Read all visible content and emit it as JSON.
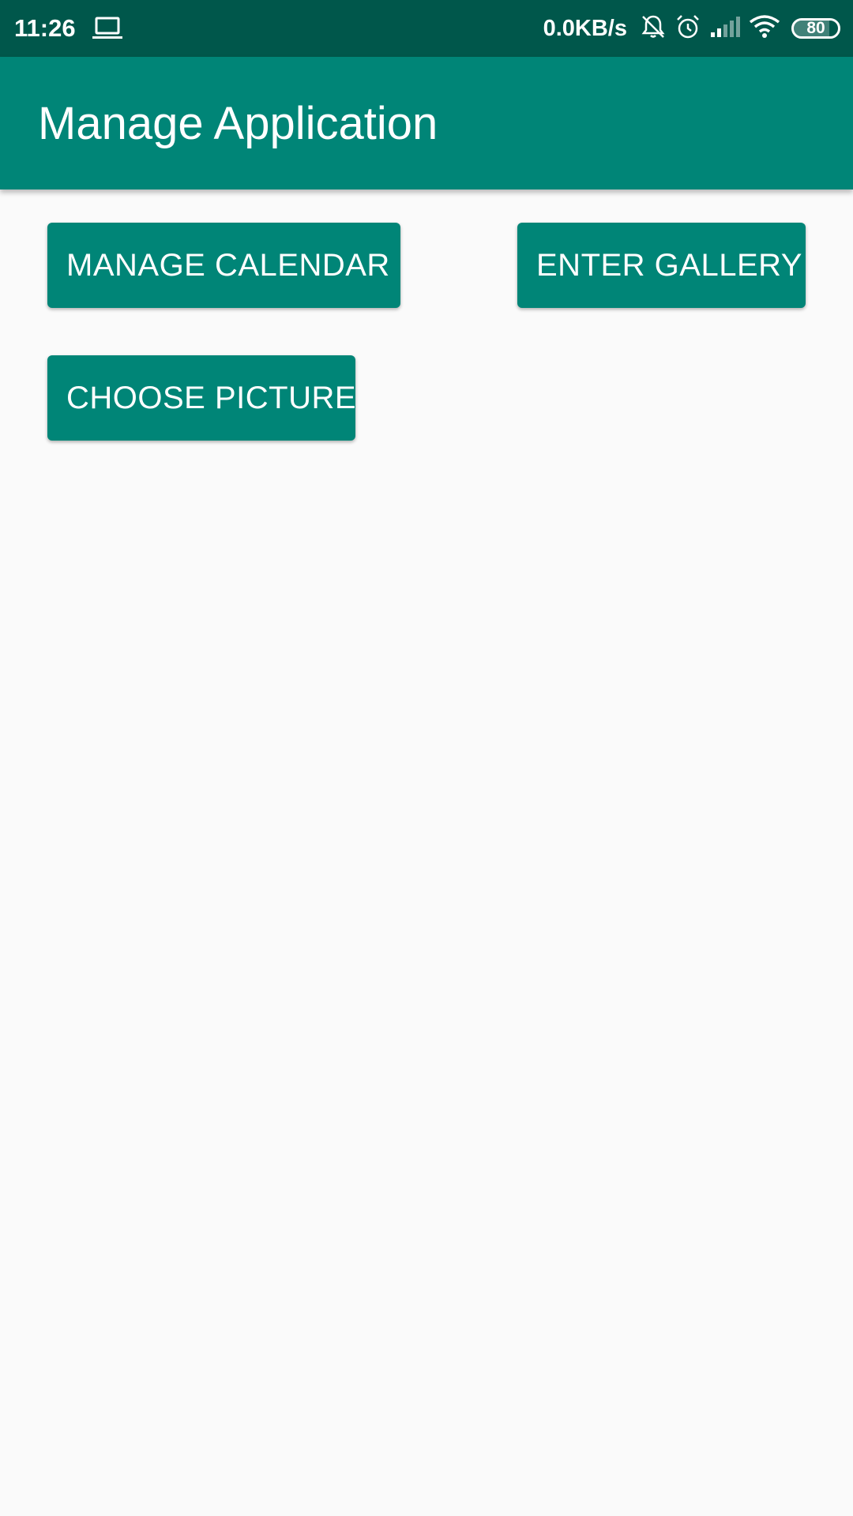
{
  "status_bar": {
    "time": "11:26",
    "left_icon": "laptop-icon",
    "net_speed": "0.0KB/s",
    "icons": [
      "bell-off-icon",
      "alarm-icon",
      "signal-icon",
      "wifi-icon"
    ],
    "battery_level": "80",
    "battery_fraction": 0.8
  },
  "app_bar": {
    "title": "Manage Application"
  },
  "buttons": {
    "manage_calendar": "MANAGE CALENDAR",
    "enter_gallery": "ENTER GALLERY",
    "choose_picture": "CHOOSE PICTURE"
  },
  "colors": {
    "status_bar": "#00574b",
    "primary": "#008577",
    "background": "#fafafa",
    "text_on_primary": "#ffffff"
  }
}
